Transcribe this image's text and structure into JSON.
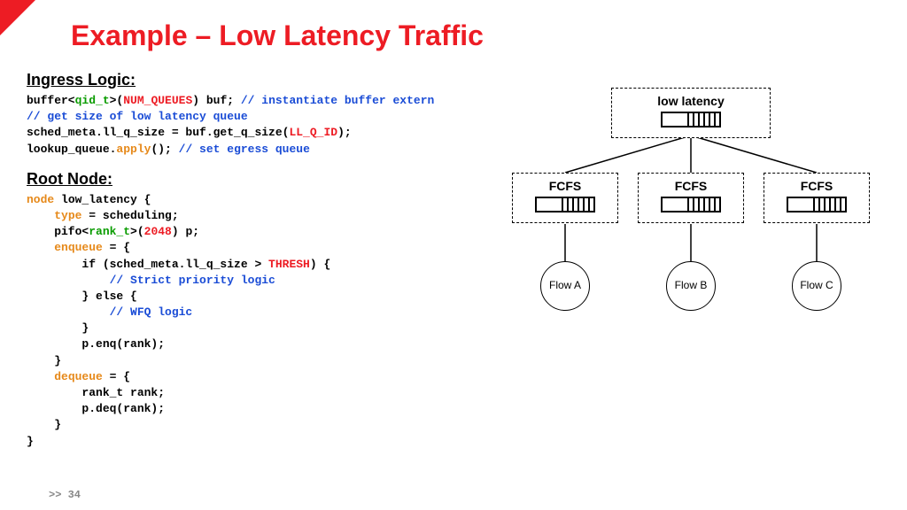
{
  "title": "Example – Low Latency Traffic",
  "sections": {
    "ingress": "Ingress Logic:",
    "root": "Root Node:"
  },
  "code": {
    "ingress": {
      "l1a": "buffer<",
      "l1b": "qid_t",
      "l1c": ">(",
      "l1d": "NUM_QUEUES",
      "l1e": ") buf; ",
      "l1f": "// instantiate buffer extern",
      "l2": "// get size of low latency queue",
      "l3a": "sched_meta.ll_q_size = buf.get_q_size(",
      "l3b": "LL_Q_ID",
      "l3c": ");",
      "l4a": "lookup_queue.",
      "l4b": "apply",
      "l4c": "(); ",
      "l4d": "// set egress queue"
    },
    "root": {
      "l1a": "node",
      "l1b": " low_latency {",
      "l2a": "    ",
      "l2b": "type",
      "l2c": " = scheduling;",
      "l3a": "    pifo<",
      "l3b": "rank_t",
      "l3c": ">(",
      "l3d": "2048",
      "l3e": ") p;",
      "l4a": "    ",
      "l4b": "enqueue",
      "l4c": " = {",
      "l5a": "        if (sched_meta.ll_q_size > ",
      "l5b": "THRESH",
      "l5c": ") {",
      "l6": "            // Strict priority logic",
      "l7": "        } else {",
      "l8": "            // WFQ logic",
      "l9": "        }",
      "l10": "        p.enq(rank);",
      "l11": "    }",
      "l12a": "    ",
      "l12b": "dequeue",
      "l12c": " = {",
      "l13": "        rank_t rank;",
      "l14": "        p.deq(rank);",
      "l15": "    }",
      "l16": "}"
    }
  },
  "diagram": {
    "top": "low latency",
    "fcfs": "FCFS",
    "flowA": "Flow\nA",
    "flowB": "Flow\nB",
    "flowC": "Flow\nC"
  },
  "footer_prefix": ">> ",
  "footer_page": "34"
}
